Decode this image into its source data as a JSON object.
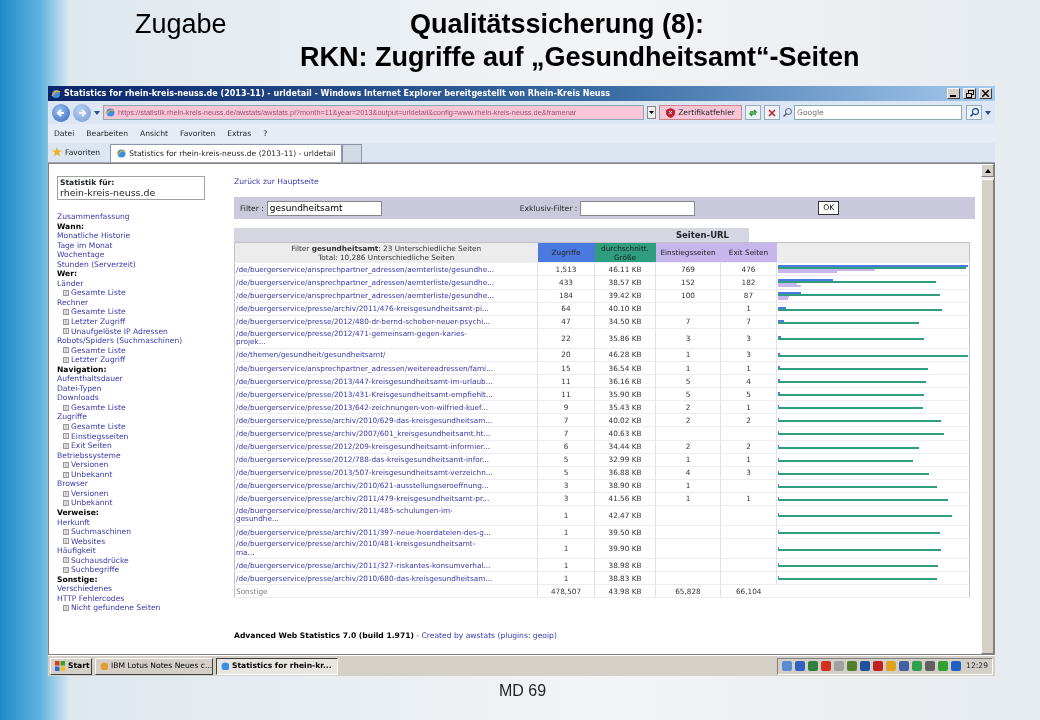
{
  "slide": {
    "left_title": "Zugabe",
    "title_line_1": "Qualitätssicherung (8):",
    "title_line_2": "RKN: Zugriffe auf „Gesundheitsamt“-Seiten",
    "footer": "MD 69"
  },
  "window": {
    "title": "Statistics for rhein-kreis-neuss.de (2013-11) - urldetail - Windows Internet Explorer bereitgestellt von Rhein-Kreis Neuss",
    "address": "https://statistik.rhein-kreis-neuss.de/awstats/awstats.pl?month=11&year=2013&output=urldetail&config=www.rhein-kreis-neuss.de&framenar",
    "cert_error": "Zertifikatfehler",
    "search_placeholder": "Google",
    "menu": [
      "Datei",
      "Bearbeiten",
      "Ansicht",
      "Favoriten",
      "Extras",
      "?"
    ],
    "favorites_label": "Favoriten",
    "tabs": [
      {
        "label": "Statistics for rhein-kreis-neuss.de (2013-11) - urldetail",
        "selected": true
      }
    ]
  },
  "sidebar": {
    "stats_label": "Statistik für:",
    "site": "rhein-kreis-neuss.de",
    "items": [
      {
        "label": "Zusammenfassung",
        "kind": "link"
      },
      {
        "label": "Wann:",
        "kind": "heading"
      },
      {
        "label": "Monatliche Historie",
        "kind": "link"
      },
      {
        "label": "Tage im Monat",
        "kind": "link"
      },
      {
        "label": "Wochentage",
        "kind": "link"
      },
      {
        "label": "Stunden (Serverzeit)",
        "kind": "link"
      },
      {
        "label": "Wer:",
        "kind": "heading"
      },
      {
        "label": "Länder",
        "kind": "link",
        "children": [
          {
            "label": "Gesamte Liste",
            "kind": "link"
          }
        ]
      },
      {
        "label": "Rechner",
        "kind": "link",
        "children": [
          {
            "label": "Gesamte Liste",
            "kind": "link"
          },
          {
            "label": "Letzter Zugriff",
            "kind": "link"
          },
          {
            "label": "Unaufgelöste IP Adressen",
            "kind": "link"
          }
        ]
      },
      {
        "label": "Robots/Spiders (Suchmaschinen)",
        "kind": "link",
        "children": [
          {
            "label": "Gesamte Liste",
            "kind": "link"
          },
          {
            "label": "Letzter Zugriff",
            "kind": "link"
          }
        ]
      },
      {
        "label": "Navigation:",
        "kind": "heading"
      },
      {
        "label": "Aufenthaltsdauer",
        "kind": "link"
      },
      {
        "label": "Datei-Typen",
        "kind": "link"
      },
      {
        "label": "Downloads",
        "kind": "link",
        "children": [
          {
            "label": "Gesamte Liste",
            "kind": "link"
          }
        ]
      },
      {
        "label": "Zugriffe",
        "kind": "link",
        "children": [
          {
            "label": "Gesamte Liste",
            "kind": "link"
          },
          {
            "label": "Einstiegsseiten",
            "kind": "link"
          },
          {
            "label": "Exit Seiten",
            "kind": "link"
          }
        ]
      },
      {
        "label": "Betriebssysteme",
        "kind": "link",
        "children": [
          {
            "label": "Versionen",
            "kind": "link"
          },
          {
            "label": "Unbekannt",
            "kind": "link"
          }
        ]
      },
      {
        "label": "Browser",
        "kind": "link",
        "children": [
          {
            "label": "Versionen",
            "kind": "link"
          },
          {
            "label": "Unbekannt",
            "kind": "link"
          }
        ]
      },
      {
        "label": "Verweise:",
        "kind": "heading"
      },
      {
        "label": "Herkunft",
        "kind": "link",
        "children": [
          {
            "label": "Suchmaschinen",
            "kind": "link"
          },
          {
            "label": "Websites",
            "kind": "link"
          }
        ]
      },
      {
        "label": "Häufigkeit",
        "kind": "link",
        "children": [
          {
            "label": "Suchausdrücke",
            "kind": "link"
          },
          {
            "label": "Suchbegriffe",
            "kind": "link"
          }
        ]
      },
      {
        "label": "Sonstige:",
        "kind": "heading"
      },
      {
        "label": "Verschiedenes",
        "kind": "link"
      },
      {
        "label": "HTTP Fehlercodes",
        "kind": "link",
        "children": [
          {
            "label": "Nicht gefundene Seiten",
            "kind": "link"
          }
        ]
      }
    ]
  },
  "main": {
    "back_link": "Zurück zur Hauptseite",
    "filter_label": "Filter :",
    "filter_value": "gesundheitsamt",
    "exclusive_label": "Exklusiv-Filter :",
    "ok_button": "OK",
    "section_title": "Seiten-URL",
    "filter_summary": "Filter **gesundheitsamt**: 23 Unterschiedliche Seiten",
    "total_summary": "Total: 10,286 Unterschiedliche Seiten",
    "columns": [
      {
        "label": "Zugriffe",
        "kind": "hits",
        "color": "#4a7ae0"
      },
      {
        "label": "durchschnitt. Größe",
        "kind": "size",
        "color": "#2e9e7e"
      },
      {
        "label": "Einstiegsseiten",
        "kind": "entry",
        "color": "#c6b6ec"
      },
      {
        "label": "Exit Seiten",
        "kind": "exit",
        "color": "#c6b6ec"
      }
    ],
    "rows": [
      {
        "url": "/de/buergerservice/ansprechpartner_adressen/aemterliste/gesundhe...",
        "wrapped": false,
        "hits": "1,513",
        "size": "46.11 KB",
        "entry": "769",
        "exit": "476",
        "bars": [
          {
            "kind": "hits",
            "level": 1.0
          },
          {
            "kind": "size",
            "level": 0.99
          },
          {
            "kind": "entry",
            "level": 0.51
          },
          {
            "kind": "exit",
            "level": 0.31
          }
        ]
      },
      {
        "url": "/de/buergerservice/ansprechpartner_adressen/aemterliste/gesundhe...",
        "wrapped": false,
        "hits": "433",
        "size": "38.57 KB",
        "entry": "152",
        "exit": "182",
        "bars": [
          {
            "kind": "hits",
            "level": 0.29
          },
          {
            "kind": "size",
            "level": 0.83
          },
          {
            "kind": "entry",
            "level": 0.1
          },
          {
            "kind": "exit",
            "level": 0.12
          }
        ]
      },
      {
        "url": "/de/buergerservice/ansprechpartner_adressen/aemterliste/gesundhe...",
        "wrapped": false,
        "hits": "184",
        "size": "39.42 KB",
        "entry": "100",
        "exit": "87",
        "bars": [
          {
            "kind": "hits",
            "level": 0.12
          },
          {
            "kind": "size",
            "level": 0.85
          },
          {
            "kind": "entry",
            "level": 0.06
          },
          {
            "kind": "exit",
            "level": 0.05
          }
        ]
      },
      {
        "url": "/de/buergerservice/presse/archiv/2011/476-kreisgesundheitsamt-pi...",
        "wrapped": false,
        "hits": "64",
        "size": "40.10 KB",
        "exit": "1",
        "bars": [
          {
            "kind": "hits",
            "level": 0.04
          },
          {
            "kind": "size",
            "level": 0.865
          }
        ]
      },
      {
        "url": "/de/buergerservice/presse/2012/480-dr-bernd-schober-neuer-psychi...",
        "wrapped": false,
        "hits": "47",
        "size": "34.50 KB",
        "entry": "7",
        "exit": "7",
        "bars": [
          {
            "kind": "hits",
            "level": 0.03
          },
          {
            "kind": "size",
            "level": 0.74
          }
        ]
      },
      {
        "url": "/de/buergerservice/presse/2012/471-gemeinsam-gegen-karies-projek...",
        "wrapped": true,
        "hits": "22",
        "size": "35.86 KB",
        "entry": "3",
        "exit": "3",
        "bars": [
          {
            "kind": "hits",
            "level": 0.015
          },
          {
            "kind": "size",
            "level": 0.77
          }
        ]
      },
      {
        "url": "/de/themen/gesundheit/gesundheitsamt/",
        "wrapped": false,
        "hits": "20",
        "size": "46.28 KB",
        "entry": "1",
        "exit": "3",
        "bars": [
          {
            "kind": "hits",
            "level": 0.013
          },
          {
            "kind": "size",
            "level": 1.0
          }
        ]
      },
      {
        "url": "/de/buergerservice/ansprechpartner_adressen/weitereadressen/fami...",
        "wrapped": false,
        "hits": "15",
        "size": "36.54 KB",
        "entry": "1",
        "exit": "1",
        "bars": [
          {
            "kind": "hits",
            "level": 0.01
          },
          {
            "kind": "size",
            "level": 0.79
          }
        ]
      },
      {
        "url": "/de/buergerservice/presse/2013/447-kreisgesundheitsamt-im-urlaub...",
        "wrapped": false,
        "hits": "11",
        "size": "36.16 KB",
        "entry": "5",
        "exit": "4",
        "bars": [
          {
            "kind": "hits",
            "level": 0.008
          },
          {
            "kind": "size",
            "level": 0.78
          }
        ]
      },
      {
        "url": "/de/buergerservice/presse/2013/431-Kreisgesundheitsamt-empfiehlt...",
        "wrapped": false,
        "hits": "11",
        "size": "35.90 KB",
        "entry": "5",
        "exit": "5",
        "bars": [
          {
            "kind": "hits",
            "level": 0.008
          },
          {
            "kind": "size",
            "level": 0.77
          }
        ]
      },
      {
        "url": "/de/buergerservice/presse/2013/642-zeichnungen-von-wilfried-kuef...",
        "wrapped": false,
        "hits": "9",
        "size": "35.43 KB",
        "entry": "2",
        "exit": "1",
        "bars": [
          {
            "kind": "hits",
            "level": 0.006
          },
          {
            "kind": "size",
            "level": 0.765
          }
        ]
      },
      {
        "url": "/de/buergerservice/presse/archiv/2010/629-das-kreisgesundheitsam...",
        "wrapped": false,
        "hits": "7",
        "size": "40.02 KB",
        "entry": "2",
        "exit": "2",
        "bars": [
          {
            "kind": "hits",
            "level": 0.005
          },
          {
            "kind": "size",
            "level": 0.86
          }
        ]
      },
      {
        "url": "/de/buergerservice/presse/archiv/2007/601_kreisgesundheitsamt.ht...",
        "wrapped": false,
        "hits": "7",
        "size": "40.63 KB",
        "bars": [
          {
            "kind": "hits",
            "level": 0.005
          },
          {
            "kind": "size",
            "level": 0.875
          }
        ]
      },
      {
        "url": "/de/buergerservice/presse/2012/209-kreisgesundheitsamt-informier...",
        "wrapped": false,
        "hits": "6",
        "size": "34.44 KB",
        "entry": "2",
        "exit": "2",
        "bars": [
          {
            "kind": "hits",
            "level": 0.005
          },
          {
            "kind": "size",
            "level": 0.74
          }
        ]
      },
      {
        "url": "/de/buergerservice/presse/2012/788-das-kreisgesundheitsamt-infor...",
        "wrapped": false,
        "hits": "5",
        "size": "32.99 KB",
        "entry": "1",
        "exit": "1",
        "bars": [
          {
            "kind": "hits",
            "level": 0.005
          },
          {
            "kind": "size",
            "level": 0.71
          }
        ]
      },
      {
        "url": "/de/buergerservice/presse/2013/507-kreisgesundheitsamt-verzeichn...",
        "wrapped": false,
        "hits": "5",
        "size": "36.88 KB",
        "entry": "4",
        "exit": "3",
        "bars": [
          {
            "kind": "hits",
            "level": 0.005
          },
          {
            "kind": "size",
            "level": 0.795
          }
        ]
      },
      {
        "url": "/de/buergerservice/presse/archiv/2010/621-ausstellungseroeffnung...",
        "wrapped": false,
        "hits": "3",
        "size": "38.90 KB",
        "entry": "1",
        "bars": [
          {
            "kind": "hits",
            "level": 0.005
          },
          {
            "kind": "size",
            "level": 0.835
          }
        ]
      },
      {
        "url": "/de/buergerservice/presse/archiv/2011/479-kreisgesundheitsamt-pr...",
        "wrapped": false,
        "hits": "3",
        "size": "41.56 KB",
        "entry": "1",
        "exit": "1",
        "bars": [
          {
            "kind": "hits",
            "level": 0.005
          },
          {
            "kind": "size",
            "level": 0.895
          }
        ]
      },
      {
        "url": "/de/buergerservice/presse/archiv/2011/485-schulungen-im-gesundhe...",
        "wrapped": true,
        "hits": "1",
        "size": "42.47 KB",
        "bars": [
          {
            "kind": "hits",
            "level": 0.005
          },
          {
            "kind": "size",
            "level": 0.915
          }
        ]
      },
      {
        "url": "/de/buergerservice/presse/archiv/2011/397-neue-hoerdateien-des-g...",
        "wrapped": false,
        "hits": "1",
        "size": "39.50 KB",
        "bars": [
          {
            "kind": "hits",
            "level": 0.005
          },
          {
            "kind": "size",
            "level": 0.85
          }
        ]
      },
      {
        "url": "/de/buergerservice/presse/archiv/2010/481-kreisgesundheitsamt-ma...",
        "wrapped": true,
        "hits": "1",
        "size": "39.90 KB",
        "bars": [
          {
            "kind": "hits",
            "level": 0.005
          },
          {
            "kind": "size",
            "level": 0.86
          }
        ]
      },
      {
        "url": "/de/buergerservice/presse/archiv/2011/327-riskantes-konsumverhal...",
        "wrapped": false,
        "hits": "1",
        "size": "38.98 KB",
        "bars": [
          {
            "kind": "hits",
            "level": 0.005
          },
          {
            "kind": "size",
            "level": 0.84
          }
        ]
      },
      {
        "url": "/de/buergerservice/presse/archiv/2010/680-das-kreisgesundheitsam...",
        "wrapped": false,
        "hits": "1",
        "size": "38.83 KB",
        "bars": [
          {
            "kind": "hits",
            "level": 0.005
          },
          {
            "kind": "size",
            "level": 0.835
          }
        ]
      }
    ],
    "other_row": {
      "label": "Sonstige",
      "hits": "478,507",
      "size": "43.98 KB",
      "entry": "65,828",
      "exit": "66,104"
    },
    "footer": "**Advanced Web Statistics 7.0 (build 1.971)** - Created by awstats (plugins: geoip)"
  },
  "taskbar": {
    "start": "Start",
    "buttons": [
      {
        "label": "IBM Lotus Notes Neues c...",
        "selected": false
      },
      {
        "label": "Statistics for rhein-kr...",
        "selected": true
      }
    ],
    "clock": "12:29"
  }
}
